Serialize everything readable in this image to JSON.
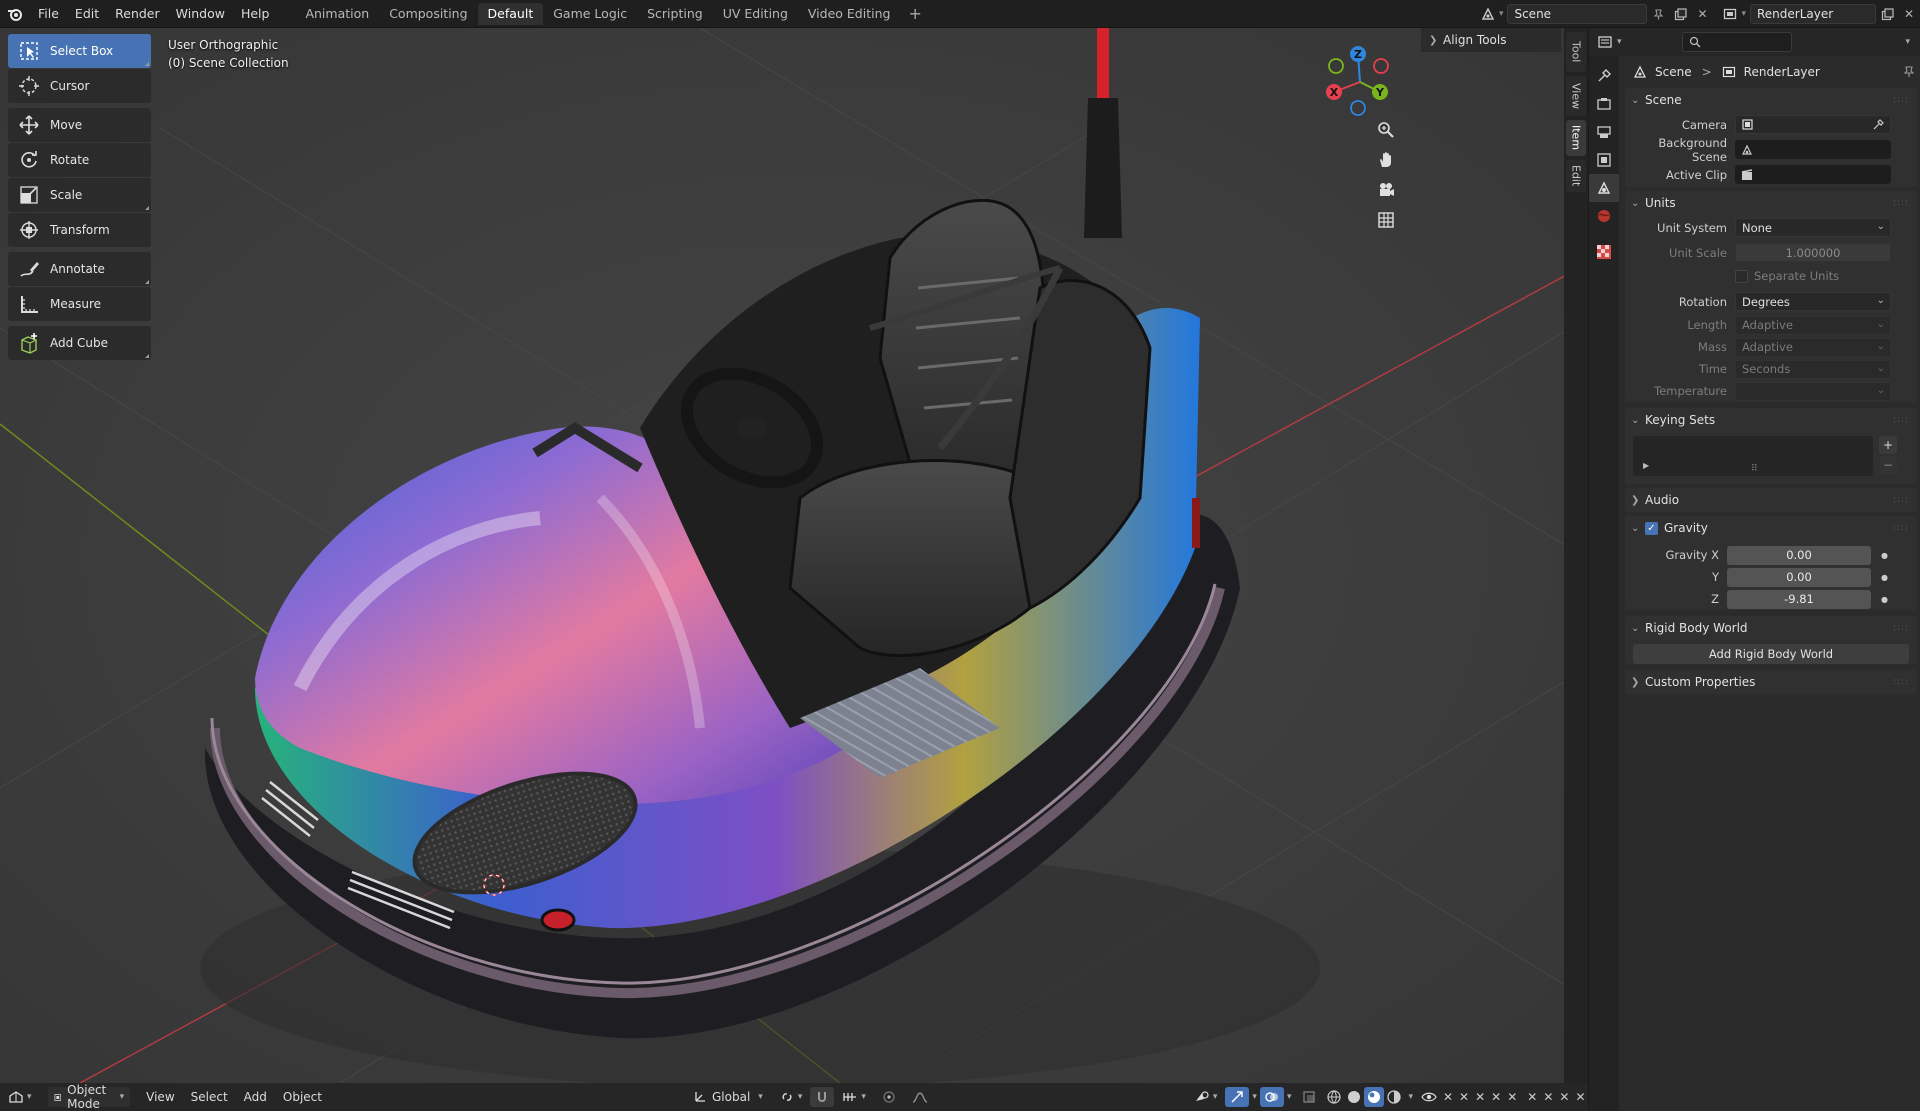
{
  "topbar": {
    "menus": [
      "File",
      "Edit",
      "Render",
      "Window",
      "Help"
    ],
    "workspaces": [
      "Animation",
      "Compositing",
      "Default",
      "Game Logic",
      "Scripting",
      "UV Editing",
      "Video Editing"
    ],
    "active_workspace": "Default",
    "add_workspace": "+",
    "scene_name": "Scene",
    "view_layer": "RenderLayer"
  },
  "viewport": {
    "view_name": "User Orthographic",
    "collection": "(0) Scene Collection",
    "align_tools": "Align Tools",
    "gizmo": {
      "x": "X",
      "y": "Y",
      "z": "Z"
    }
  },
  "toolbar": {
    "tools": [
      {
        "label": "Select Box",
        "icon": "select-box-icon"
      },
      {
        "label": "Cursor",
        "icon": "cursor-icon"
      },
      {
        "label": "Move",
        "icon": "move-icon"
      },
      {
        "label": "Rotate",
        "icon": "rotate-icon"
      },
      {
        "label": "Scale",
        "icon": "scale-icon"
      },
      {
        "label": "Transform",
        "icon": "transform-icon"
      },
      {
        "label": "Annotate",
        "icon": "annotate-icon"
      },
      {
        "label": "Measure",
        "icon": "measure-icon"
      },
      {
        "label": "Add Cube",
        "icon": "add-cube-icon"
      }
    ],
    "active_tool": "Select Box"
  },
  "ntabs": [
    "Tool",
    "View",
    "Item",
    "Edit"
  ],
  "ntab_active": "Item",
  "header": {
    "mode": "Object Mode",
    "menus": [
      "View",
      "Select",
      "Add",
      "Object"
    ],
    "orientation": "Global"
  },
  "properties": {
    "breadcrumb": {
      "scene": "Scene",
      "sep": ">",
      "layer": "RenderLayer"
    },
    "scene_panel": {
      "title": "Scene",
      "camera_label": "Camera",
      "background_scene_label": "Background Scene",
      "active_clip_label": "Active Clip"
    },
    "units_panel": {
      "title": "Units",
      "unit_system_label": "Unit System",
      "unit_system": "None",
      "unit_scale_label": "Unit Scale",
      "unit_scale": "1.000000",
      "separate_units": "Separate Units",
      "rotation_label": "Rotation",
      "rotation": "Degrees",
      "length_label": "Length",
      "length": "Adaptive",
      "mass_label": "Mass",
      "mass": "Adaptive",
      "time_label": "Time",
      "time": "Seconds",
      "temperature_label": "Temperature",
      "temperature": ""
    },
    "keying_sets": {
      "title": "Keying Sets",
      "add": "+",
      "remove": "−"
    },
    "audio": {
      "title": "Audio"
    },
    "gravity": {
      "title": "Gravity",
      "enabled": true,
      "x_label": "Gravity X",
      "x": "0.00",
      "y_label": "Y",
      "y": "0.00",
      "z_label": "Z",
      "z": "-9.81"
    },
    "rigid_body": {
      "title": "Rigid Body World",
      "add_button": "Add Rigid Body World"
    },
    "custom_props": {
      "title": "Custom Properties"
    }
  },
  "colors": {
    "accent": "#4772b3",
    "x_axis": "#e6404e",
    "y_axis": "#7ab51d",
    "z_axis": "#2e86de",
    "viewport_bg": "#3d3d3d"
  }
}
